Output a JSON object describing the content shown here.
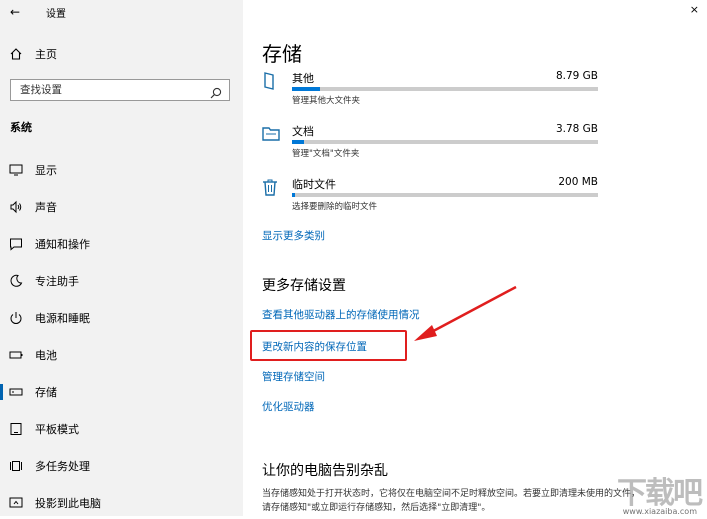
{
  "window": {
    "title": "设置",
    "close_label": "×"
  },
  "sidebar": {
    "home_label": "主页",
    "search_placeholder": "查找设置",
    "section_heading": "系统",
    "items": [
      {
        "label": "显示",
        "icon": "display-icon"
      },
      {
        "label": "声音",
        "icon": "sound-icon"
      },
      {
        "label": "通知和操作",
        "icon": "notification-icon"
      },
      {
        "label": "专注助手",
        "icon": "focus-assist-icon"
      },
      {
        "label": "电源和睡眠",
        "icon": "power-icon"
      },
      {
        "label": "电池",
        "icon": "battery-icon"
      },
      {
        "label": "存储",
        "icon": "storage-icon",
        "active": true
      },
      {
        "label": "平板模式",
        "icon": "tablet-mode-icon"
      },
      {
        "label": "多任务处理",
        "icon": "multitasking-icon"
      },
      {
        "label": "投影到此电脑",
        "icon": "project-icon"
      }
    ]
  },
  "main": {
    "title": "存储",
    "storage_items": [
      {
        "name": "其他",
        "size": "8.79 GB",
        "desc": "管理其他大文件夹",
        "fill_percent": 9,
        "icon": "other-file-icon"
      },
      {
        "name": "文档",
        "size": "3.78 GB",
        "desc": "管理\"文档\"文件夹",
        "fill_percent": 4,
        "icon": "documents-folder-icon"
      },
      {
        "name": "临时文件",
        "size": "200 MB",
        "desc": "选择要删除的临时文件",
        "fill_percent": 1,
        "icon": "trash-icon"
      }
    ],
    "show_more_link": "显示更多类别",
    "more_settings_heading": "更多存储设置",
    "links": [
      "查看其他驱动器上的存储使用情况",
      "更改新内容的保存位置",
      "管理存储空间",
      "优化驱动器"
    ],
    "clutter_heading": "让你的电脑告别杂乱",
    "clutter_text_1": "当存储感知处于打开状态时，它将仅在电脑空间不足时释放空间。若要立即清理未使用的文件，",
    "clutter_text_2": "请存储感知\"或立即运行存储感知，然后选择\"立即清理\"。"
  },
  "colors": {
    "accent": "#0078d7",
    "link": "#0067b8",
    "annotation_red": "#e01e1e"
  },
  "watermark": {
    "text": "下载吧",
    "url_text": "www.xiazaiba.com"
  }
}
